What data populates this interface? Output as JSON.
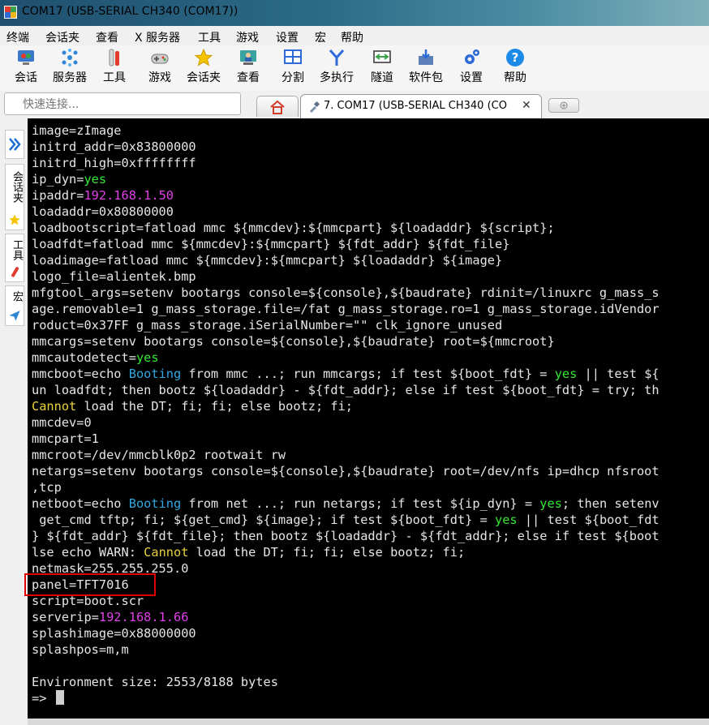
{
  "window": {
    "title": "COM17  (USB-SERIAL CH340 (COM17))"
  },
  "menu": {
    "items": [
      "终端",
      "会话夹",
      "查看",
      "X 服务器",
      "工具",
      "游戏",
      "设置",
      "宏",
      "帮助"
    ]
  },
  "toolbar": {
    "items": [
      {
        "label": "会话",
        "icon": "session-icon"
      },
      {
        "label": "服务器",
        "icon": "servers-icon"
      },
      {
        "label": "工具",
        "icon": "tools-icon"
      },
      {
        "label": "游戏",
        "icon": "games-icon"
      },
      {
        "label": "会话夹",
        "icon": "star-icon"
      },
      {
        "label": "查看",
        "icon": "view-icon"
      },
      {
        "label": "分割",
        "icon": "split-icon"
      },
      {
        "label": "多执行",
        "icon": "multiexec-icon"
      },
      {
        "label": "隧道",
        "icon": "tunnel-icon"
      },
      {
        "label": "软件包",
        "icon": "packages-icon"
      },
      {
        "label": "设置",
        "icon": "settings-icon"
      },
      {
        "label": "帮助",
        "icon": "help-icon"
      }
    ]
  },
  "quick_connect": {
    "placeholder": "快速连接..."
  },
  "tabs": {
    "active_label": "7. COM17  (USB-SERIAL CH340 (CO",
    "close": "✕"
  },
  "sidebar": {
    "labels": [
      "会话夹",
      "工具",
      "宏"
    ]
  },
  "terminal": {
    "lines": [
      [
        {
          "t": "image=zImage"
        }
      ],
      [
        {
          "t": "initrd_addr=0x83800000"
        }
      ],
      [
        {
          "t": "initrd_high=0xffffffff"
        }
      ],
      [
        {
          "t": "ip_dyn="
        },
        {
          "t": "yes",
          "c": "yes"
        }
      ],
      [
        {
          "t": "ipaddr="
        },
        {
          "t": "192.168.1.50",
          "c": "ip"
        }
      ],
      [
        {
          "t": "loadaddr=0x80800000"
        }
      ],
      [
        {
          "t": "loadbootscript=fatload mmc ${mmcdev}:${mmcpart} ${loadaddr} ${script};"
        }
      ],
      [
        {
          "t": "loadfdt=fatload mmc ${mmcdev}:${mmcpart} ${fdt_addr} ${fdt_file}"
        }
      ],
      [
        {
          "t": "loadimage=fatload mmc ${mmcdev}:${mmcpart} ${loadaddr} ${image}"
        }
      ],
      [
        {
          "t": "logo_file=alientek.bmp"
        }
      ],
      [
        {
          "t": "mfgtool_args=setenv bootargs console=${console},${baudrate} rdinit=/linuxrc g_mass_s"
        }
      ],
      [
        {
          "t": "age.removable=1 g_mass_storage.file=/fat g_mass_storage.ro=1 g_mass_storage.idVendor"
        }
      ],
      [
        {
          "t": "roduct=0x37FF g_mass_storage.iSerialNumber=\"\" clk_ignore_unused"
        }
      ],
      [
        {
          "t": "mmcargs=setenv bootargs console=${console},${baudrate} root=${mmcroot}"
        }
      ],
      [
        {
          "t": "mmcautodetect="
        },
        {
          "t": "yes",
          "c": "yes"
        }
      ],
      [
        {
          "t": "mmcboot=echo "
        },
        {
          "t": "Booting",
          "c": "boot"
        },
        {
          "t": " from mmc ...; run mmcargs; if test ${boot_fdt} = "
        },
        {
          "t": "yes",
          "c": "yes"
        },
        {
          "t": " || test ${"
        }
      ],
      [
        {
          "t": "un loadfdt; then bootz ${loadaddr} - ${fdt_addr}; else if test ${boot_fdt} = try; th"
        }
      ],
      [
        {
          "t": "Cannot",
          "c": "cannot"
        },
        {
          "t": " load the DT; fi; fi; else bootz; fi;"
        }
      ],
      [
        {
          "t": "mmcdev=0"
        }
      ],
      [
        {
          "t": "mmcpart=1"
        }
      ],
      [
        {
          "t": "mmcroot=/dev/mmcblk0p2 rootwait rw"
        }
      ],
      [
        {
          "t": "netargs=setenv bootargs console=${console},${baudrate} root=/dev/nfs ip=dhcp nfsroot"
        }
      ],
      [
        {
          "t": ",tcp"
        }
      ],
      [
        {
          "t": "netboot=echo "
        },
        {
          "t": "Booting",
          "c": "boot"
        },
        {
          "t": " from net ...; run netargs; if test ${ip_dyn} = "
        },
        {
          "t": "yes",
          "c": "yes"
        },
        {
          "t": "; then setenv"
        }
      ],
      [
        {
          "t": " get_cmd tftp; fi; ${get_cmd} ${image}; if test ${boot_fdt} = "
        },
        {
          "t": "yes",
          "c": "yes"
        },
        {
          "t": " || test ${boot_fdt"
        }
      ],
      [
        {
          "t": "} ${fdt_addr} ${fdt_file}; then bootz ${loadaddr} - ${fdt_addr}; else if test ${boot"
        }
      ],
      [
        {
          "t": "lse echo WARN: "
        },
        {
          "t": "Cannot",
          "c": "cannot"
        },
        {
          "t": " load the DT; fi; fi; else bootz; fi;"
        }
      ],
      [
        {
          "t": "netmask=255.255.255.0"
        }
      ],
      [
        {
          "t": "panel=TFT7016"
        }
      ],
      [
        {
          "t": "script=boot.scr"
        }
      ],
      [
        {
          "t": "serverip="
        },
        {
          "t": "192.168.1.66",
          "c": "ip"
        }
      ],
      [
        {
          "t": "splashimage=0x88000000"
        }
      ],
      [
        {
          "t": "splashpos=m,m"
        }
      ],
      [
        {
          "t": ""
        }
      ],
      [
        {
          "t": "Environment size: 2553/8188 bytes"
        }
      ],
      [
        {
          "t": "=> "
        }
      ]
    ]
  },
  "colors": {
    "terminal_bg": "#000000",
    "terminal_fg": "#e6e6e6",
    "keyword_yes": "#35e835",
    "ip_address": "#e040e8",
    "booting": "#32a8e0",
    "cannot": "#e8d23a",
    "highlight_box": "#e00000"
  }
}
